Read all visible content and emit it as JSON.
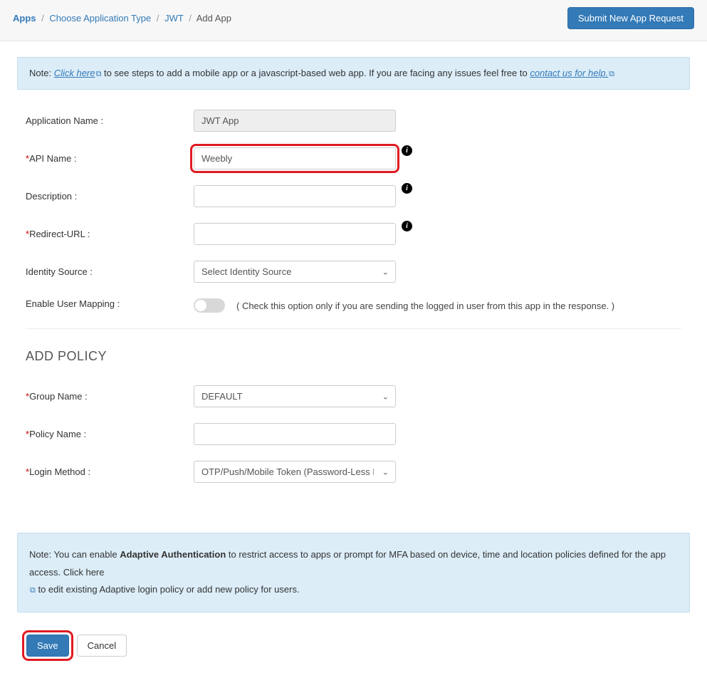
{
  "breadcrumb": {
    "apps": "Apps",
    "choose_type": "Choose Application Type",
    "jwt": "JWT",
    "current": "Add App"
  },
  "header": {
    "submit_button": "Submit New App Request"
  },
  "top_note": {
    "prefix": "Note: ",
    "link1": "Click here",
    "mid": " to see steps to add a mobile app or a javascript-based web app. If you are facing any issues feel free to ",
    "link2": "contact us for help."
  },
  "form": {
    "app_name_label": "Application Name :",
    "app_name_value": "JWT App",
    "api_name_label": "API Name :",
    "api_name_value": "Weebly",
    "description_label": "Description :",
    "description_value": "",
    "redirect_label": "Redirect-URL :",
    "redirect_value": "",
    "identity_label": "Identity Source :",
    "identity_placeholder": "Select Identity Source",
    "mapping_label": "Enable User Mapping :",
    "mapping_hint": "( Check this option only if you are sending the logged in user from this app in the response. )"
  },
  "policy": {
    "title": "ADD POLICY",
    "group_label": "Group Name :",
    "group_value": "DEFAULT",
    "policy_name_label": "Policy Name :",
    "policy_name_value": "",
    "login_method_label": "Login Method :",
    "login_method_value": "OTP/Push/Mobile Token (Password-Less Login)"
  },
  "bottom_note": {
    "prefix": "Note: You can enable ",
    "bold": "Adaptive Authentication",
    "mid": " to restrict access to apps or prompt for MFA based on device, time and location policies defined for the app access. ",
    "link": "Click here",
    "suffix": " to edit existing Adaptive login policy or add new policy for users."
  },
  "actions": {
    "save": "Save",
    "cancel": "Cancel"
  }
}
